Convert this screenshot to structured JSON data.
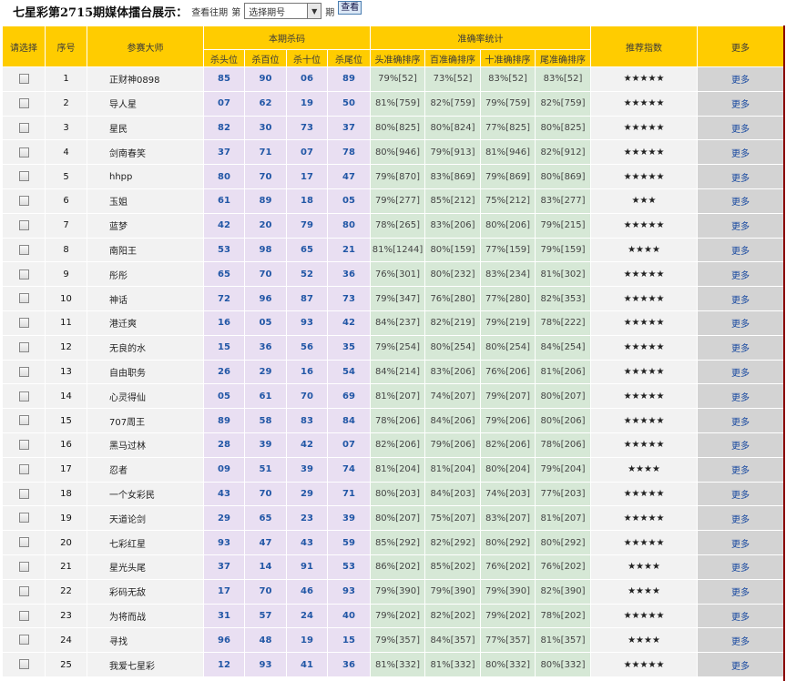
{
  "header": {
    "title": "七星彩第2715期媒体擂台展示：",
    "view_label": "查看往期",
    "prefix": "第",
    "select_value": "选择期号",
    "suffix": "期",
    "query_button": "查看"
  },
  "table": {
    "headers": {
      "select": "请选择",
      "index": "序号",
      "name": "参赛大师",
      "kill_group": "本期杀码",
      "accuracy_group": "准确率统计",
      "recommend": "推荐指数",
      "more": "更多"
    },
    "kill_cols": [
      "杀头位",
      "杀百位",
      "杀十位",
      "杀尾位"
    ],
    "acc_cols": [
      "头准确排序",
      "百准确排序",
      "十准确排序",
      "尾准确排序"
    ],
    "more_text": "更多",
    "rows": [
      {
        "idx": "1",
        "name": "正财神0898",
        "kill": [
          "85",
          "90",
          "06",
          "89"
        ],
        "acc": [
          "79%[52]",
          "73%[52]",
          "83%[52]",
          "83%[52]"
        ],
        "stars": "★★★★★"
      },
      {
        "idx": "2",
        "name": "导人星",
        "kill": [
          "07",
          "62",
          "19",
          "50"
        ],
        "acc": [
          "81%[759]",
          "82%[759]",
          "79%[759]",
          "82%[759]"
        ],
        "stars": "★★★★★"
      },
      {
        "idx": "3",
        "name": "星民",
        "kill": [
          "82",
          "30",
          "73",
          "37"
        ],
        "acc": [
          "80%[825]",
          "80%[824]",
          "77%[825]",
          "80%[825]"
        ],
        "stars": "★★★★★"
      },
      {
        "idx": "4",
        "name": "剑南春笑",
        "kill": [
          "37",
          "71",
          "07",
          "78"
        ],
        "acc": [
          "80%[946]",
          "79%[913]",
          "81%[946]",
          "82%[912]"
        ],
        "stars": "★★★★★"
      },
      {
        "idx": "5",
        "name": "hhpp",
        "kill": [
          "80",
          "70",
          "17",
          "47"
        ],
        "acc": [
          "79%[870]",
          "83%[869]",
          "79%[869]",
          "80%[869]"
        ],
        "stars": "★★★★★"
      },
      {
        "idx": "6",
        "name": "玉姐",
        "kill": [
          "61",
          "89",
          "18",
          "05"
        ],
        "acc": [
          "79%[277]",
          "85%[212]",
          "75%[212]",
          "83%[277]"
        ],
        "stars": "★★★"
      },
      {
        "idx": "7",
        "name": "蓝梦",
        "kill": [
          "42",
          "20",
          "79",
          "80"
        ],
        "acc": [
          "78%[265]",
          "83%[206]",
          "80%[206]",
          "79%[215]"
        ],
        "stars": "★★★★★"
      },
      {
        "idx": "8",
        "name": "南阳王",
        "kill": [
          "53",
          "98",
          "65",
          "21"
        ],
        "acc": [
          "81%[1244]",
          "80%[159]",
          "77%[159]",
          "79%[159]"
        ],
        "stars": "★★★★"
      },
      {
        "idx": "9",
        "name": "彤彤",
        "kill": [
          "65",
          "70",
          "52",
          "36"
        ],
        "acc": [
          "76%[301]",
          "80%[232]",
          "83%[234]",
          "81%[302]"
        ],
        "stars": "★★★★★"
      },
      {
        "idx": "10",
        "name": "神话",
        "kill": [
          "72",
          "96",
          "87",
          "73"
        ],
        "acc": [
          "79%[347]",
          "76%[280]",
          "77%[280]",
          "82%[353]"
        ],
        "stars": "★★★★★"
      },
      {
        "idx": "11",
        "name": "港迁爽",
        "kill": [
          "16",
          "05",
          "93",
          "42"
        ],
        "acc": [
          "84%[237]",
          "82%[219]",
          "79%[219]",
          "78%[222]"
        ],
        "stars": "★★★★★"
      },
      {
        "idx": "12",
        "name": "无良的水",
        "kill": [
          "15",
          "36",
          "56",
          "35"
        ],
        "acc": [
          "79%[254]",
          "80%[254]",
          "80%[254]",
          "84%[254]"
        ],
        "stars": "★★★★★"
      },
      {
        "idx": "13",
        "name": "自由职务",
        "kill": [
          "26",
          "29",
          "16",
          "54"
        ],
        "acc": [
          "84%[214]",
          "83%[206]",
          "76%[206]",
          "81%[206]"
        ],
        "stars": "★★★★★"
      },
      {
        "idx": "14",
        "name": "心灵得仙",
        "kill": [
          "05",
          "61",
          "70",
          "69"
        ],
        "acc": [
          "81%[207]",
          "74%[207]",
          "79%[207]",
          "80%[207]"
        ],
        "stars": "★★★★★"
      },
      {
        "idx": "15",
        "name": "707周王",
        "kill": [
          "89",
          "58",
          "83",
          "84"
        ],
        "acc": [
          "78%[206]",
          "84%[206]",
          "79%[206]",
          "80%[206]"
        ],
        "stars": "★★★★★"
      },
      {
        "idx": "16",
        "name": "黑马过林",
        "kill": [
          "28",
          "39",
          "42",
          "07"
        ],
        "acc": [
          "82%[206]",
          "79%[206]",
          "82%[206]",
          "78%[206]"
        ],
        "stars": "★★★★★"
      },
      {
        "idx": "17",
        "name": "忍者",
        "kill": [
          "09",
          "51",
          "39",
          "74"
        ],
        "acc": [
          "81%[204]",
          "81%[204]",
          "80%[204]",
          "79%[204]"
        ],
        "stars": "★★★★"
      },
      {
        "idx": "18",
        "name": "一个女彩民",
        "kill": [
          "43",
          "70",
          "29",
          "71"
        ],
        "acc": [
          "80%[203]",
          "84%[203]",
          "74%[203]",
          "77%[203]"
        ],
        "stars": "★★★★★"
      },
      {
        "idx": "19",
        "name": "天道论剑",
        "kill": [
          "29",
          "65",
          "23",
          "39"
        ],
        "acc": [
          "80%[207]",
          "75%[207]",
          "83%[207]",
          "81%[207]"
        ],
        "stars": "★★★★★"
      },
      {
        "idx": "20",
        "name": "七彩红星",
        "kill": [
          "93",
          "47",
          "43",
          "59"
        ],
        "acc": [
          "85%[292]",
          "82%[292]",
          "80%[292]",
          "80%[292]"
        ],
        "stars": "★★★★★"
      },
      {
        "idx": "21",
        "name": "星光头尾",
        "kill": [
          "37",
          "14",
          "91",
          "53"
        ],
        "acc": [
          "86%[202]",
          "85%[202]",
          "76%[202]",
          "76%[202]"
        ],
        "stars": "★★★★"
      },
      {
        "idx": "22",
        "name": "彩码无敌",
        "kill": [
          "17",
          "70",
          "46",
          "93"
        ],
        "acc": [
          "79%[390]",
          "79%[390]",
          "79%[390]",
          "82%[390]"
        ],
        "stars": "★★★★"
      },
      {
        "idx": "23",
        "name": "为将而战",
        "kill": [
          "31",
          "57",
          "24",
          "40"
        ],
        "acc": [
          "79%[202]",
          "82%[202]",
          "79%[202]",
          "78%[202]"
        ],
        "stars": "★★★★★"
      },
      {
        "idx": "24",
        "name": "寻找",
        "kill": [
          "96",
          "48",
          "19",
          "15"
        ],
        "acc": [
          "79%[357]",
          "84%[357]",
          "77%[357]",
          "81%[357]"
        ],
        "stars": "★★★★"
      },
      {
        "idx": "25",
        "name": "我爱七星彩",
        "kill": [
          "12",
          "93",
          "41",
          "36"
        ],
        "acc": [
          "81%[332]",
          "81%[332]",
          "80%[332]",
          "80%[332]"
        ],
        "stars": "★★★★★"
      }
    ]
  }
}
